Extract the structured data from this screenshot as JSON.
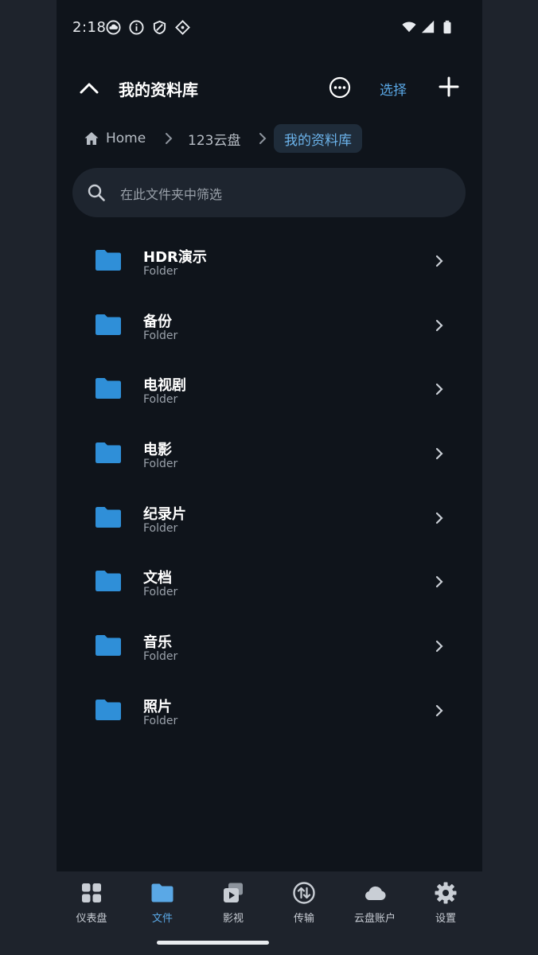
{
  "status": {
    "time": "2:18"
  },
  "header": {
    "title": "我的资料库",
    "select_label": "选择"
  },
  "breadcrumb": {
    "home": "Home",
    "level1": "123云盘",
    "current": "我的资料库"
  },
  "search": {
    "placeholder": "在此文件夹中筛选"
  },
  "folders": [
    {
      "name": "HDR演示",
      "type": "Folder"
    },
    {
      "name": "备份",
      "type": "Folder"
    },
    {
      "name": "电视剧",
      "type": "Folder"
    },
    {
      "name": "电影",
      "type": "Folder"
    },
    {
      "name": "纪录片",
      "type": "Folder"
    },
    {
      "name": "文档",
      "type": "Folder"
    },
    {
      "name": "音乐",
      "type": "Folder"
    },
    {
      "name": "照片",
      "type": "Folder"
    }
  ],
  "nav": [
    {
      "label": "仪表盘",
      "icon": "dashboard-icon"
    },
    {
      "label": "文件",
      "icon": "folder-icon"
    },
    {
      "label": "影视",
      "icon": "media-icon"
    },
    {
      "label": "传输",
      "icon": "transfer-icon"
    },
    {
      "label": "云盘账户",
      "icon": "cloud-icon"
    },
    {
      "label": "设置",
      "icon": "gear-icon"
    }
  ],
  "colors": {
    "accent": "#5aa8e6",
    "folder": "#2f8fd8",
    "background": "#0f141b"
  }
}
